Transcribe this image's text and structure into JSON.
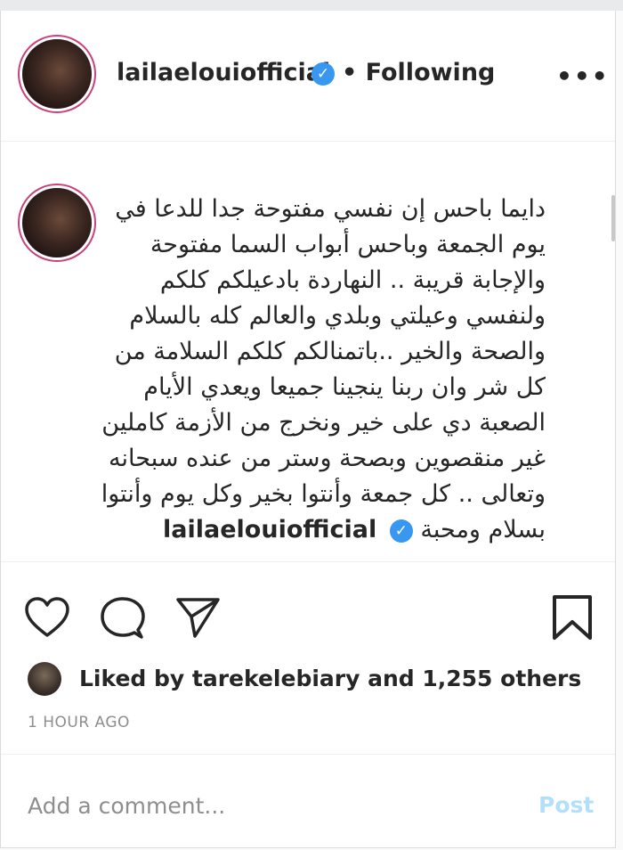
{
  "header": {
    "username": "lailaelouiofficial",
    "verified_glyph": "✓",
    "follow_status": "• Following",
    "more_glyph": "•••"
  },
  "caption": {
    "username": "lailaelouiofficial",
    "verified_glyph": "✓",
    "text": "دايما باحس إن نفسي مفتوحة جدا للدعا في يوم الجمعة وباحس أبواب السما مفتوحة والإجابة قريبة .. النهاردة بادعيلكم كلكم ولنفسي وعيلتي وبلدي والعالم كله بالسلام والصحة والخير ..باتمنالكم كلكم السلامة من كل شر وان ربنا ينجينا جميعا ويعدي الأيام الصعبة دي على خير ونخرج من الأزمة كاملين غير منقصوين وبصحة وستر من عنده سبحانه وتعالى .. كل جمعة وأنتوا بخير وكل يوم وأنتوا بسلام ومحبة"
  },
  "actions": {
    "icons": [
      "heart-icon",
      "comment-icon",
      "share-icon",
      "bookmark-icon"
    ]
  },
  "likes": {
    "text": "Liked by tarekelebiary and 1,255 others"
  },
  "timestamp": "1 HOUR AGO",
  "comment": {
    "placeholder": "Add a comment...",
    "post_label": "Post"
  },
  "colors": {
    "verified": "#3897f0",
    "post_disabled": "#b2dffc",
    "secondary_text": "#8e8e8e"
  }
}
